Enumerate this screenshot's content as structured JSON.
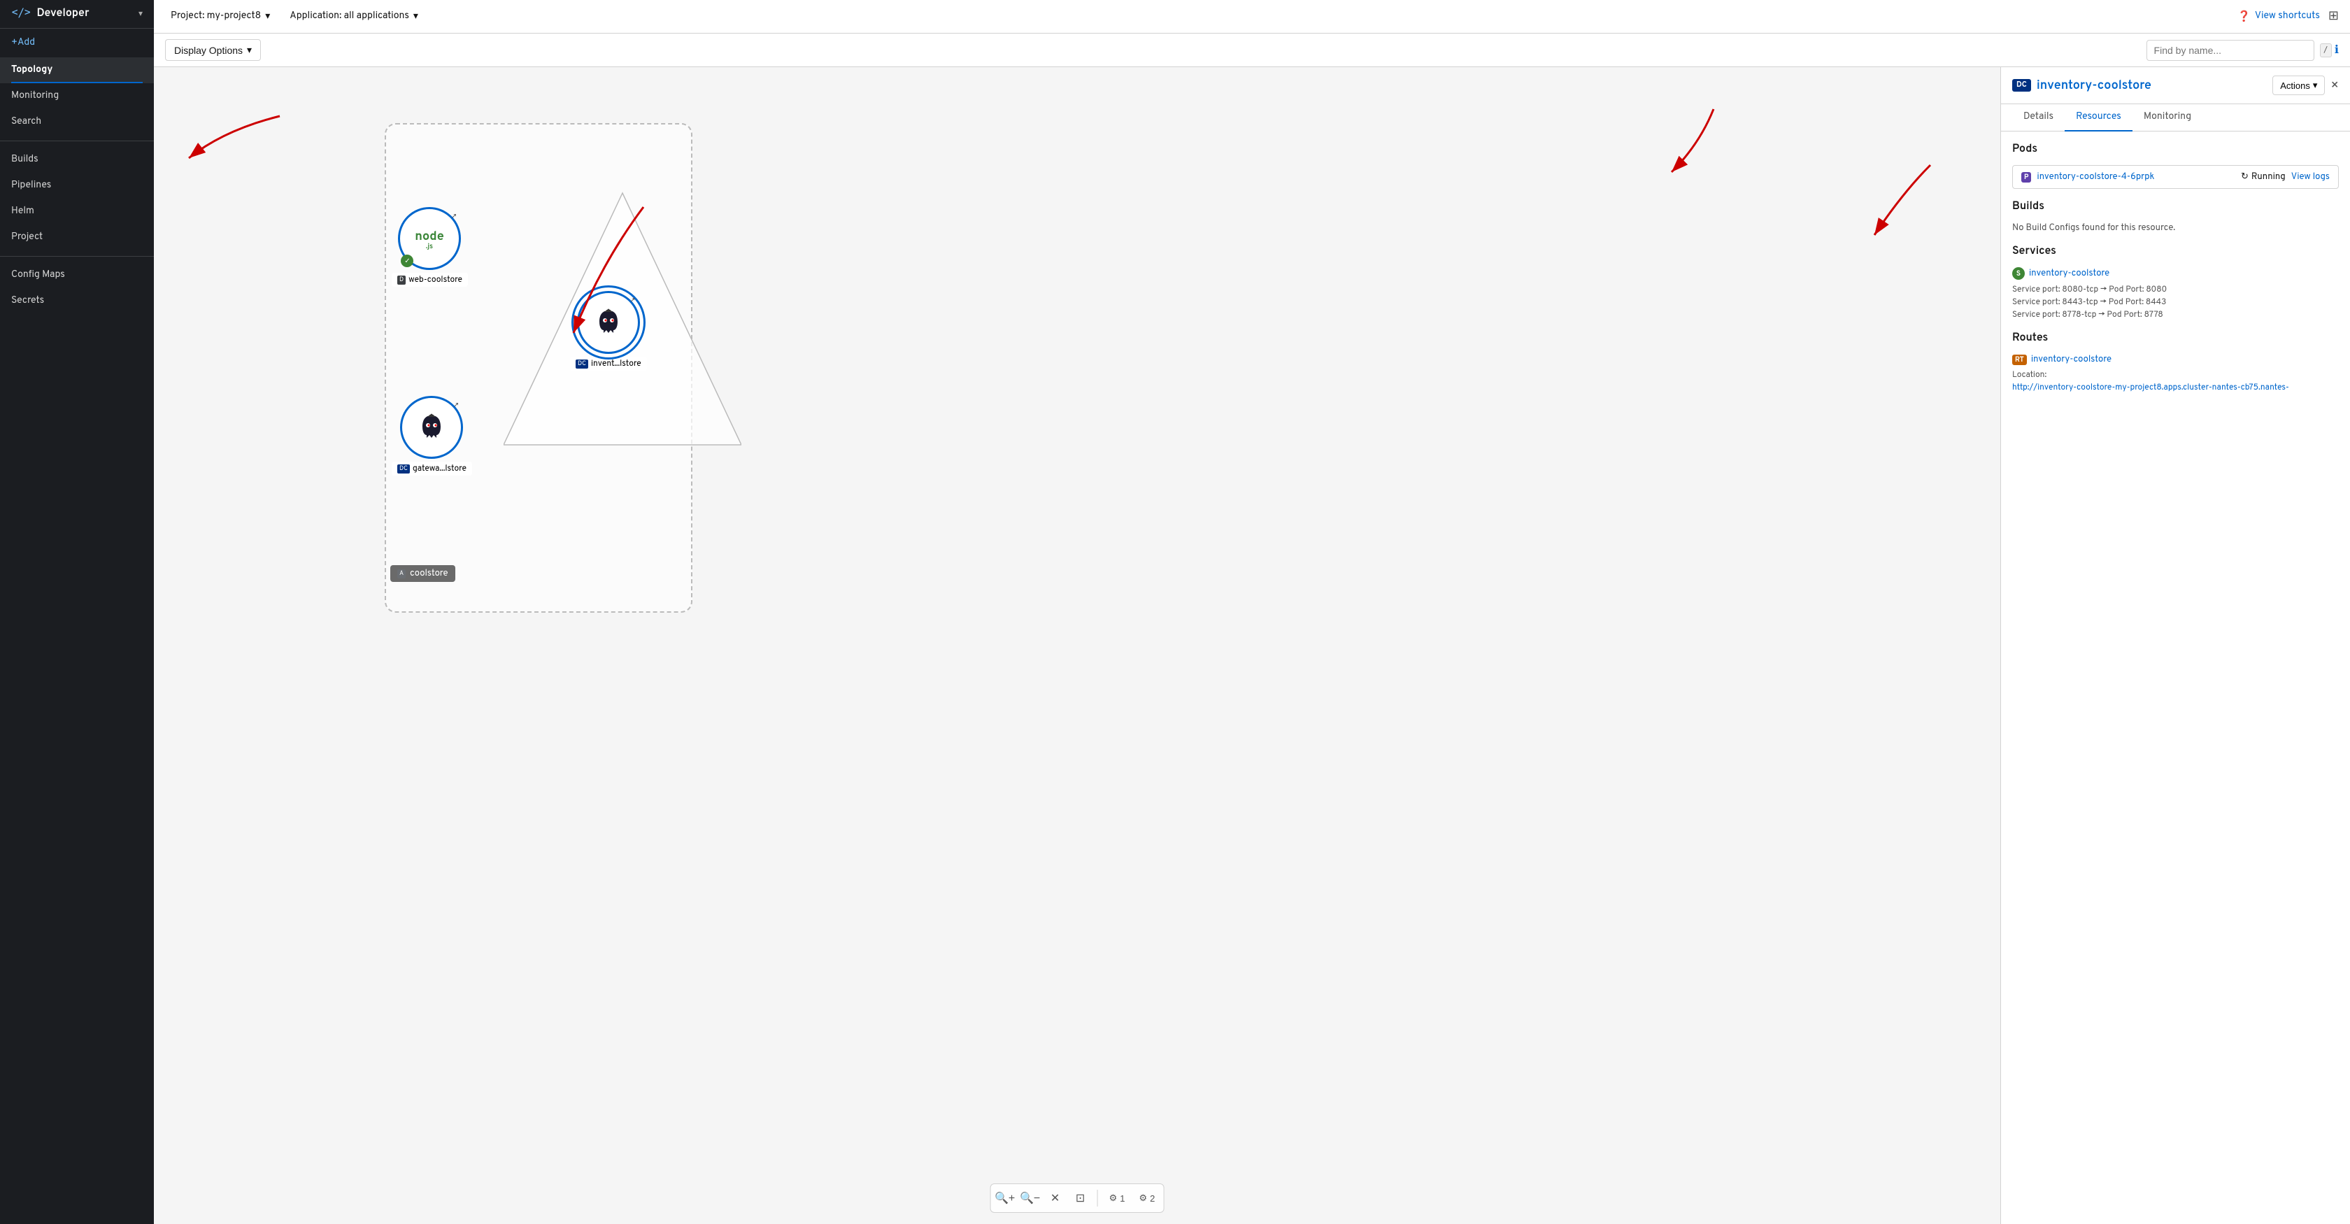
{
  "sidebar": {
    "title": "Developer",
    "add_label": "+Add",
    "items": [
      {
        "id": "topology",
        "label": "Topology",
        "active": true
      },
      {
        "id": "monitoring",
        "label": "Monitoring",
        "active": false
      },
      {
        "id": "search",
        "label": "Search",
        "active": false
      },
      {
        "id": "builds",
        "label": "Builds",
        "active": false
      },
      {
        "id": "pipelines",
        "label": "Pipelines",
        "active": false
      },
      {
        "id": "helm",
        "label": "Helm",
        "active": false
      },
      {
        "id": "project",
        "label": "Project",
        "active": false
      },
      {
        "id": "config-maps",
        "label": "Config Maps",
        "active": false
      },
      {
        "id": "secrets",
        "label": "Secrets",
        "active": false
      }
    ]
  },
  "topbar": {
    "project_label": "Project: my-project8",
    "application_label": "Application: all applications",
    "view_shortcuts_label": "View shortcuts"
  },
  "secondary_bar": {
    "display_options_label": "Display Options",
    "find_placeholder": "Find by name...",
    "slash_label": "/"
  },
  "topology": {
    "nodes": [
      {
        "id": "node-js",
        "label": "web-coolstore",
        "badge": "D",
        "icon": "nodejs"
      },
      {
        "id": "gateway",
        "label": "gatewa...lstore",
        "badge": "DC",
        "icon": "quarkus"
      },
      {
        "id": "inventory",
        "label": "invent...lstore",
        "badge": "DC",
        "icon": "quarkus"
      }
    ],
    "app_group_label": "coolstore",
    "app_group_badge": "A"
  },
  "right_panel": {
    "dc_badge": "DC",
    "title": "inventory-coolstore",
    "close_label": "×",
    "actions_label": "Actions",
    "tabs": [
      {
        "id": "details",
        "label": "Details",
        "active": false
      },
      {
        "id": "resources",
        "label": "Resources",
        "active": true
      },
      {
        "id": "monitoring",
        "label": "Monitoring",
        "active": false
      }
    ],
    "pods_section": {
      "title": "Pods",
      "pod": {
        "badge": "P",
        "name": "inventory-coolstore-4-6prpk",
        "status": "Running",
        "view_logs_label": "View logs"
      }
    },
    "builds_section": {
      "title": "Builds",
      "empty_message": "No Build Configs found for this resource."
    },
    "services_section": {
      "title": "Services",
      "service": {
        "badge": "S",
        "name": "inventory-coolstore",
        "ports": [
          {
            "service_port": "8080-tcp",
            "pod_port": "8080"
          },
          {
            "service_port": "8443-tcp",
            "pod_port": "8443"
          },
          {
            "service_port": "8778-tcp",
            "pod_port": "8778"
          }
        ]
      }
    },
    "routes_section": {
      "title": "Routes",
      "route": {
        "badge": "RT",
        "name": "inventory-coolstore",
        "location_label": "Location:",
        "url": "http://inventory-coolstore-my-project8.apps.cluster-nantes-cb75.nantes-"
      }
    }
  },
  "toolbar": {
    "zoom_in": "+",
    "zoom_out": "−",
    "reset": "⤢",
    "fit": "⤡",
    "group1_label": "1",
    "group2_label": "2"
  }
}
